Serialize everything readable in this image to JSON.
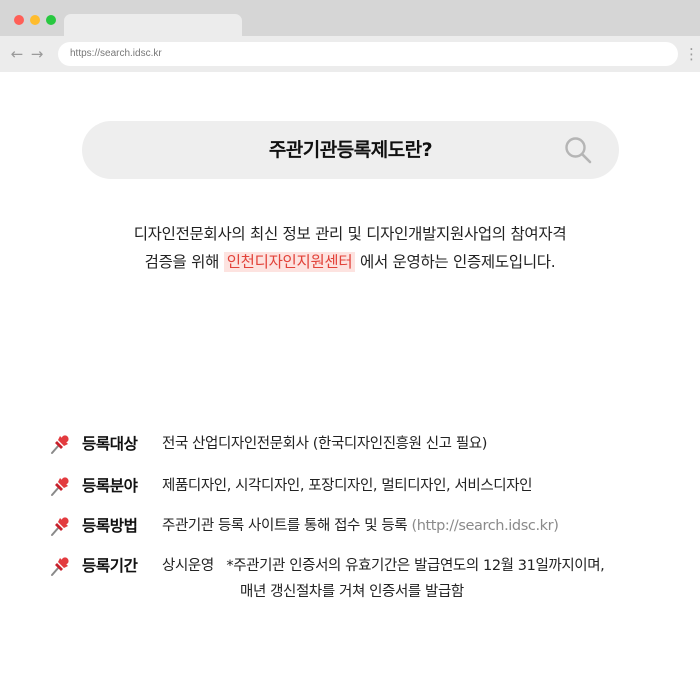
{
  "browser": {
    "url": "https://search.idsc.kr",
    "back_icon": "arrow-left-icon",
    "forward_icon": "arrow-right-icon",
    "menu_icon": "vertical-dots-icon"
  },
  "search": {
    "title": "주관기관등록제도란?",
    "icon": "search-icon"
  },
  "intro": {
    "line1": "디자인전문회사의 최신 정보 관리 및 디자인개발지원사업의 참여자격",
    "line2_before": "검증을 위해",
    "line2_highlight": "인천디자인지원센터",
    "line2_after": "에서 운영하는 인증제도입니다."
  },
  "colors": {
    "highlight_bg": "#fde3e0",
    "highlight_text": "#e2433a",
    "pill_bg": "#eeeeee"
  },
  "info": [
    {
      "label": "등록대상",
      "value": "전국 산업디자인전문회사 (한국디자인진흥원 신고 필요)"
    },
    {
      "label": "등록분야",
      "value": "제품디자인, 시각디자인, 포장디자인, 멀티디자인, 서비스디자인"
    },
    {
      "label": "등록방법",
      "value": "주관기관 등록 사이트를 통해 접수 및 등록",
      "value_muted": "(http://search.idsc.kr)"
    },
    {
      "label": "등록기간",
      "value": "상시운영   *주관기관 인증서의 유효기간은 발급연도의 12월 31일까지이며,",
      "value_cont": "매년 갱신절차를 거쳐 인증서를 발급함"
    }
  ]
}
